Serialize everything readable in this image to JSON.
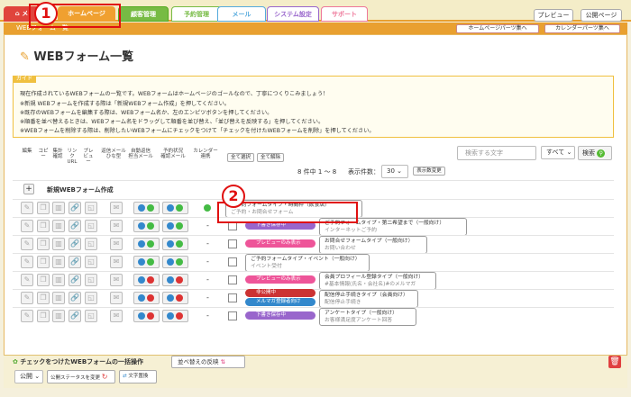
{
  "nav": {
    "tabs": [
      {
        "label": "メ",
        "color": "#e0443c"
      },
      {
        "label": "ホームページ",
        "color": "#f0a030"
      },
      {
        "label": "顧客管理",
        "color": "#77bb44"
      },
      {
        "label": "予約管理",
        "color": "#77bb44"
      },
      {
        "label": "メール",
        "color": "#55aadd"
      },
      {
        "label": "システム設定",
        "color": "#9966cc"
      },
      {
        "label": "サポート",
        "color": "#ee7799"
      }
    ],
    "preview": "プレビュー",
    "public_page": "公開ページ"
  },
  "subbar": {
    "title": "WEBフォーム一覧",
    "link1": "ホームページパーツ集へ",
    "link2": "カレンダーパーツ集へ"
  },
  "page_title": "WEBフォーム一覧",
  "guide": {
    "label": "ガイド",
    "lines": [
      "現在作成されているWEBフォームの一覧です。WEBフォームはホームページのゴールなので、丁寧につくりこみましょう！",
      "※新規 WEBフォームを作成する際は「新規WEBフォーム作成」を押してください。",
      "※既存のWEBフォームを編集する際は、WEBフォーム名か、左のエンピツボタンを押してください。",
      "※順番を並べ替えるときは、WEBフォーム名をドラッグして順番を並び替え、「並び替えを反映する」を押してください。",
      "※WEBフォームを削除する際は、削除したいWEBフォームにチェックをつけて「チェックを付けたWEBフォームを削除」を押してください。"
    ]
  },
  "columns": [
    {
      "l1": "編集",
      "l2": ""
    },
    {
      "l1": "コピー",
      "l2": ""
    },
    {
      "l1": "集計",
      "l2": "確認"
    },
    {
      "l1": "リンク",
      "l2": "URL"
    },
    {
      "l1": "プレ",
      "l2": "ビュー"
    },
    {
      "l1": "返信メール",
      "l2": "ひな型"
    },
    {
      "l1": "自動返信",
      "l2": "担当メール"
    },
    {
      "l1": "予約状況",
      "l2": "確認メール"
    },
    {
      "l1": "カレンダー",
      "l2": "連携"
    }
  ],
  "select_all": "全て選択",
  "deselect_all": "全て解除",
  "search_placeholder": "検索する文字",
  "filter_value": "すべて",
  "search_btn": "検索",
  "count_text": "8 件中 1 ～ 8",
  "per_page_label": "表示件数：",
  "per_page_value": "30",
  "per_page_btn": "表示数変更",
  "new_form": "新規WEBフォーム作成",
  "rows": [
    {
      "badges": [],
      "status": "on",
      "checkbox": false,
      "name": "ご予約フォームタイプ・時間枠（飲食店）",
      "sub": "ご予約・お問合せフォーム",
      "boxwidth": 152
    },
    {
      "badges": [
        {
          "text": "下書き保存中",
          "color": "#9966cc"
        }
      ],
      "status": "on",
      "checkbox": true,
      "name": "ご予約フォームタイプ・第二希望まで（一般向け）",
      "sub": "インターネットご予約",
      "boxwidth": 164
    },
    {
      "badges": [
        {
          "text": "プレビューのみ表示",
          "color": "#ee5599"
        }
      ],
      "status": "on",
      "checkbox": true,
      "name": "お問合せフォームタイプ（一般向け）",
      "sub": "お問い合わせ",
      "boxwidth": 120
    },
    {
      "badges": [],
      "status": "on",
      "checkbox": true,
      "name": "ご予約フォームタイプ・イベント（一般向け）",
      "sub": "イベント受付",
      "boxwidth": 138
    },
    {
      "badges": [
        {
          "text": "プレビューのみ表示",
          "color": "#ee5599"
        }
      ],
      "status": "off",
      "checkbox": true,
      "name": "会員プロフィール登録タイプ（一般向け）",
      "sub": "#基本情報(氏名・会社名)#のメルマガ",
      "boxwidth": 130
    },
    {
      "badges": [
        {
          "text": "非公開中",
          "color": "#cc3333"
        },
        {
          "text": "メルマガ登録者向け",
          "color": "#3388cc"
        }
      ],
      "status": "off",
      "checkbox": true,
      "name": "配信停止手続きタイプ（会員向け）",
      "sub": "配信停止手続き",
      "boxwidth": 110
    },
    {
      "badges": [
        {
          "text": "下書き保存中",
          "color": "#9966cc"
        }
      ],
      "status": "off",
      "checkbox": true,
      "name": "アンケートタイプ（一般向け）",
      "sub": "お客様満足度アンケート回答",
      "boxwidth": 108
    }
  ],
  "bottom": {
    "bulk_title": "チェックをつけたWEBフォームの一括操作",
    "status_select": "公開",
    "status_change": "公開ステータスを変更",
    "text_change": "文字置換",
    "reorder": "並べ替えの反映"
  },
  "annotations": [
    "1",
    "2"
  ]
}
